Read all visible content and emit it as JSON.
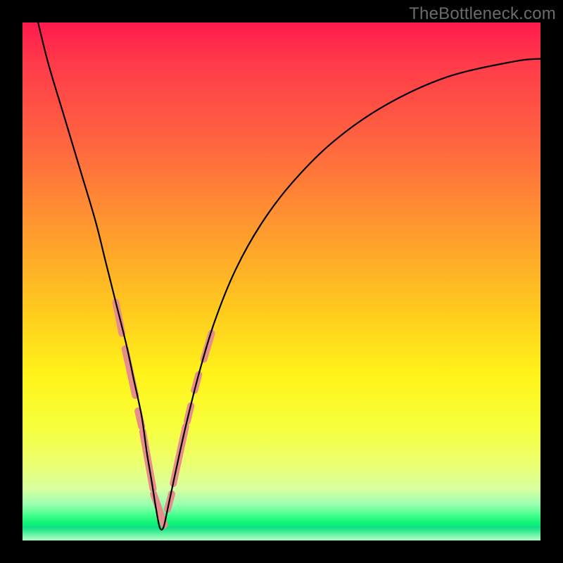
{
  "watermark": "TheBottleneck.com",
  "chart_data": {
    "type": "line",
    "title": "",
    "xlabel": "",
    "ylabel": "",
    "xlim": [
      0,
      100
    ],
    "ylim": [
      0,
      100
    ],
    "grid": false,
    "legend": false,
    "gradient_stops": [
      {
        "pos": 0,
        "color": "#ff1a4d"
      },
      {
        "pos": 25,
        "color": "#ff6a3e"
      },
      {
        "pos": 55,
        "color": "#ffc81f"
      },
      {
        "pos": 78,
        "color": "#f7ff3a"
      },
      {
        "pos": 96.5,
        "color": "#12f576"
      },
      {
        "pos": 100,
        "color": "#b6ffc8"
      }
    ],
    "series": [
      {
        "name": "bottleneck-curve",
        "color": "#000000",
        "x": [
          3,
          5,
          8,
          11,
          14,
          16,
          18,
          20,
          21.5,
          23,
          24,
          25,
          25.8,
          26.5,
          27.2,
          28,
          29.5,
          31.5,
          34,
          37,
          41,
          46,
          52,
          60,
          70,
          82,
          95,
          100
        ],
        "y": [
          100,
          92,
          82,
          72,
          62,
          54,
          46,
          38,
          31,
          24,
          17,
          11,
          6,
          2.5,
          2.5,
          6,
          13,
          22,
          32,
          42,
          52,
          61,
          69,
          77,
          84,
          89.5,
          92.5,
          93
        ]
      }
    ],
    "highlight_segments": {
      "color": "#e98c8c",
      "width": 10,
      "segments": [
        {
          "x": [
            18.0,
            19.2
          ],
          "y": [
            46,
            40
          ]
        },
        {
          "x": [
            19.8,
            21.8
          ],
          "y": [
            37,
            28
          ]
        },
        {
          "x": [
            22.3,
            23.0
          ],
          "y": [
            25,
            22
          ]
        },
        {
          "x": [
            23.2,
            25.2
          ],
          "y": [
            21,
            10
          ]
        },
        {
          "x": [
            25.3,
            27.4
          ],
          "y": [
            9,
            3
          ]
        },
        {
          "x": [
            28.0,
            28.8
          ],
          "y": [
            6,
            9
          ]
        },
        {
          "x": [
            29.1,
            31.5
          ],
          "y": [
            11,
            22
          ]
        },
        {
          "x": [
            31.8,
            32.5
          ],
          "y": [
            23,
            26
          ]
        },
        {
          "x": [
            33.2,
            34.0
          ],
          "y": [
            29,
            32
          ]
        },
        {
          "x": [
            35.0,
            36.5
          ],
          "y": [
            35,
            40
          ]
        }
      ]
    }
  }
}
